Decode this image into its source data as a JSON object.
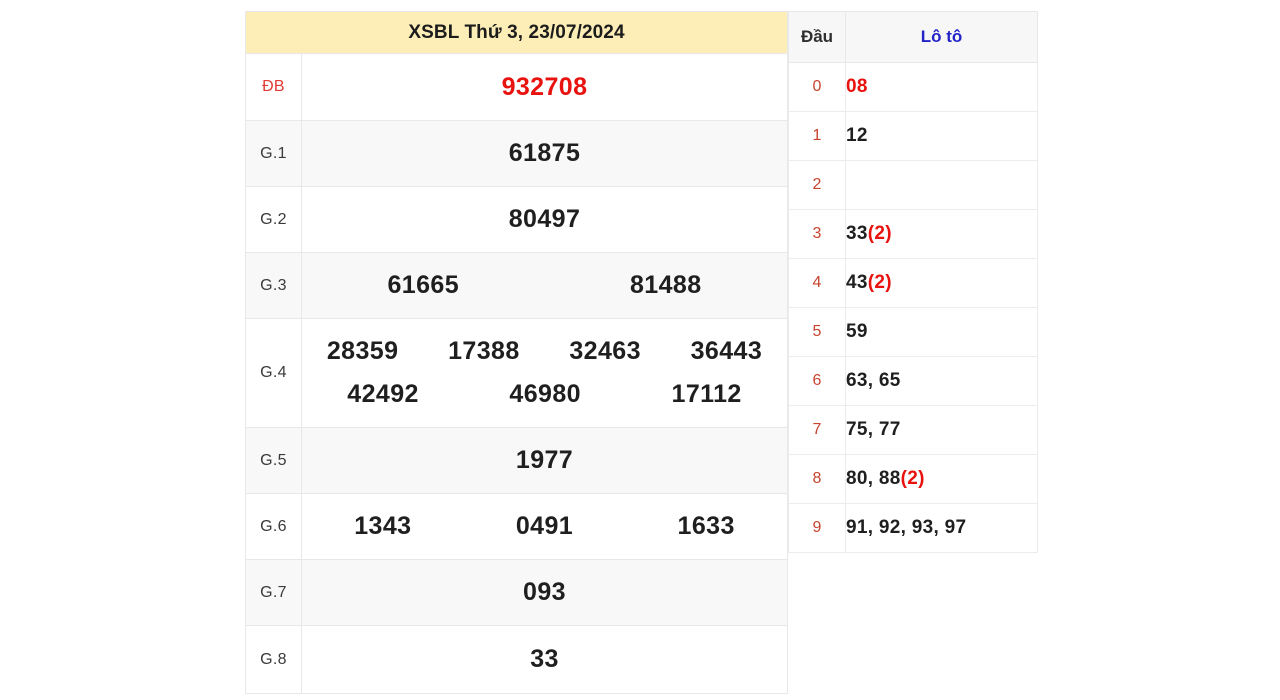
{
  "result": {
    "title": "XSBL Thứ 3, 23/07/2024",
    "rows": [
      {
        "label": "ĐB",
        "special": true,
        "lines": [
          [
            "932708"
          ]
        ]
      },
      {
        "label": "G.1",
        "special": false,
        "lines": [
          [
            "61875"
          ]
        ]
      },
      {
        "label": "G.2",
        "special": false,
        "lines": [
          [
            "80497"
          ]
        ]
      },
      {
        "label": "G.3",
        "special": false,
        "lines": [
          [
            "61665",
            "81488"
          ]
        ]
      },
      {
        "label": "G.4",
        "special": false,
        "lines": [
          [
            "28359",
            "17388",
            "32463",
            "36443"
          ],
          [
            "42492",
            "46980",
            "17112"
          ]
        ]
      },
      {
        "label": "G.5",
        "special": false,
        "lines": [
          [
            "1977"
          ]
        ]
      },
      {
        "label": "G.6",
        "special": false,
        "lines": [
          [
            "1343",
            "0491",
            "1633"
          ]
        ]
      },
      {
        "label": "G.7",
        "special": false,
        "lines": [
          [
            "093"
          ]
        ]
      },
      {
        "label": "G.8",
        "special": false,
        "lines": [
          [
            "33"
          ]
        ]
      }
    ]
  },
  "loto": {
    "header": {
      "head_label": "Đầu",
      "values_label": "Lô tô"
    },
    "rows": [
      {
        "head": "0",
        "values": "08",
        "mult": "",
        "highlight": true
      },
      {
        "head": "1",
        "values": "12",
        "mult": "",
        "highlight": false
      },
      {
        "head": "2",
        "values": "",
        "mult": "",
        "highlight": false
      },
      {
        "head": "3",
        "values": "33",
        "mult": "(2)",
        "highlight": false
      },
      {
        "head": "4",
        "values": "43",
        "mult": "(2)",
        "highlight": false
      },
      {
        "head": "5",
        "values": "59",
        "mult": "",
        "highlight": false
      },
      {
        "head": "6",
        "values": "63, 65",
        "mult": "",
        "highlight": false
      },
      {
        "head": "7",
        "values": "75, 77",
        "mult": "",
        "highlight": false
      },
      {
        "head": "8",
        "values": "80, 88",
        "mult": "(2)",
        "highlight": false
      },
      {
        "head": "9",
        "values": "91, 92, 93, 97",
        "mult": "",
        "highlight": false
      }
    ]
  },
  "colors": {
    "title_bg": "#fdeeb8",
    "special_red": "#e8120f",
    "loto_blue": "#2323c8",
    "head_red": "#c7442f",
    "zebra_bg": "#f8f8f8"
  }
}
